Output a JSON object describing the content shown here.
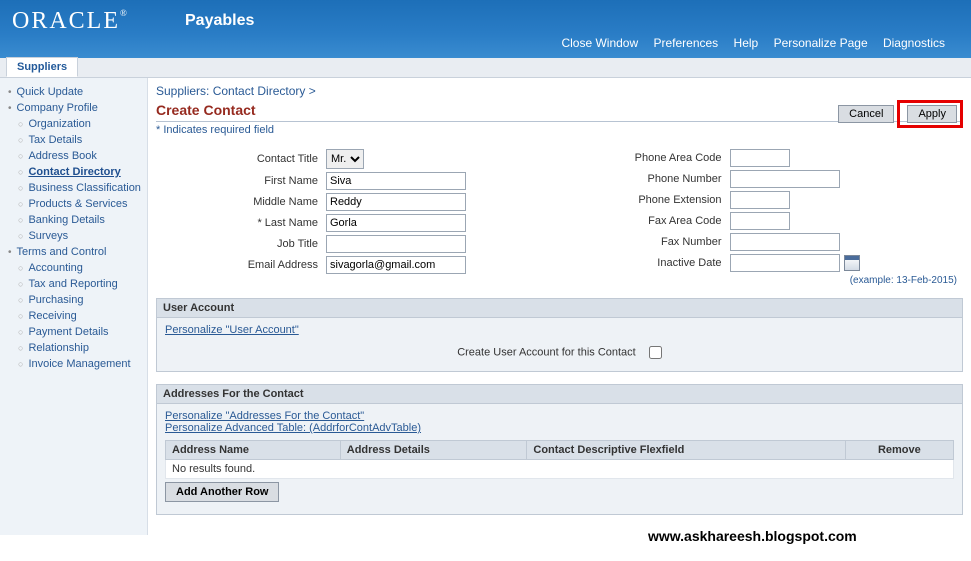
{
  "header": {
    "brand": "ORACLE",
    "module": "Payables",
    "nav": [
      "Close Window",
      "Preferences",
      "Help",
      "Personalize Page",
      "Diagnostics"
    ]
  },
  "tab": "Suppliers",
  "sidebar": {
    "items": [
      {
        "level": 1,
        "label": "Quick Update",
        "active": false
      },
      {
        "level": 1,
        "label": "Company Profile",
        "active": false
      },
      {
        "level": 2,
        "label": "Organization",
        "active": false
      },
      {
        "level": 2,
        "label": "Tax Details",
        "active": false
      },
      {
        "level": 2,
        "label": "Address Book",
        "active": false
      },
      {
        "level": 2,
        "label": "Contact Directory",
        "active": true
      },
      {
        "level": 2,
        "label": "Business Classification",
        "active": false
      },
      {
        "level": 2,
        "label": "Products & Services",
        "active": false
      },
      {
        "level": 2,
        "label": "Banking Details",
        "active": false
      },
      {
        "level": 2,
        "label": "Surveys",
        "active": false
      },
      {
        "level": 1,
        "label": "Terms and Control",
        "active": false
      },
      {
        "level": 2,
        "label": "Accounting",
        "active": false
      },
      {
        "level": 2,
        "label": "Tax and Reporting",
        "active": false
      },
      {
        "level": 2,
        "label": "Purchasing",
        "active": false
      },
      {
        "level": 2,
        "label": "Receiving",
        "active": false
      },
      {
        "level": 2,
        "label": "Payment Details",
        "active": false
      },
      {
        "level": 2,
        "label": "Relationship",
        "active": false
      },
      {
        "level": 2,
        "label": "Invoice Management",
        "active": false
      }
    ]
  },
  "breadcrumb": "Suppliers: Contact Directory  >",
  "page_title": "Create Contact",
  "required_note": "*  Indicates required field",
  "buttons": {
    "cancel": "Cancel",
    "apply": "Apply"
  },
  "form": {
    "left": {
      "contact_title": {
        "label": "Contact Title",
        "value": "Mr."
      },
      "first_name": {
        "label": "First Name",
        "value": "Siva"
      },
      "middle_name": {
        "label": "Middle Name",
        "value": "Reddy"
      },
      "last_name": {
        "label": "* Last Name",
        "value": "Gorla"
      },
      "job_title": {
        "label": "Job Title",
        "value": ""
      },
      "email": {
        "label": "Email Address",
        "value": "sivagorla@gmail.com"
      }
    },
    "right": {
      "phone_area": {
        "label": "Phone Area Code",
        "value": ""
      },
      "phone_number": {
        "label": "Phone Number",
        "value": ""
      },
      "phone_ext": {
        "label": "Phone Extension",
        "value": ""
      },
      "fax_area": {
        "label": "Fax Area Code",
        "value": ""
      },
      "fax_number": {
        "label": "Fax Number",
        "value": ""
      },
      "inactive_date": {
        "label": "Inactive Date",
        "value": ""
      }
    },
    "example": "(example: 13-Feb-2015)"
  },
  "user_account": {
    "title": "User Account",
    "personalize": "Personalize \"User Account\"",
    "checkbox_label": "Create User Account for this Contact"
  },
  "addresses": {
    "title": "Addresses For the Contact",
    "personalize1": "Personalize \"Addresses For the Contact\"",
    "personalize2": "Personalize Advanced Table: (AddrforContAdvTable)",
    "columns": [
      "Address Name",
      "Address Details",
      "Contact Descriptive Flexfield",
      "Remove"
    ],
    "empty": "No results found.",
    "add_row": "Add Another Row"
  },
  "watermark": "www.askhareesh.blogspot.com"
}
